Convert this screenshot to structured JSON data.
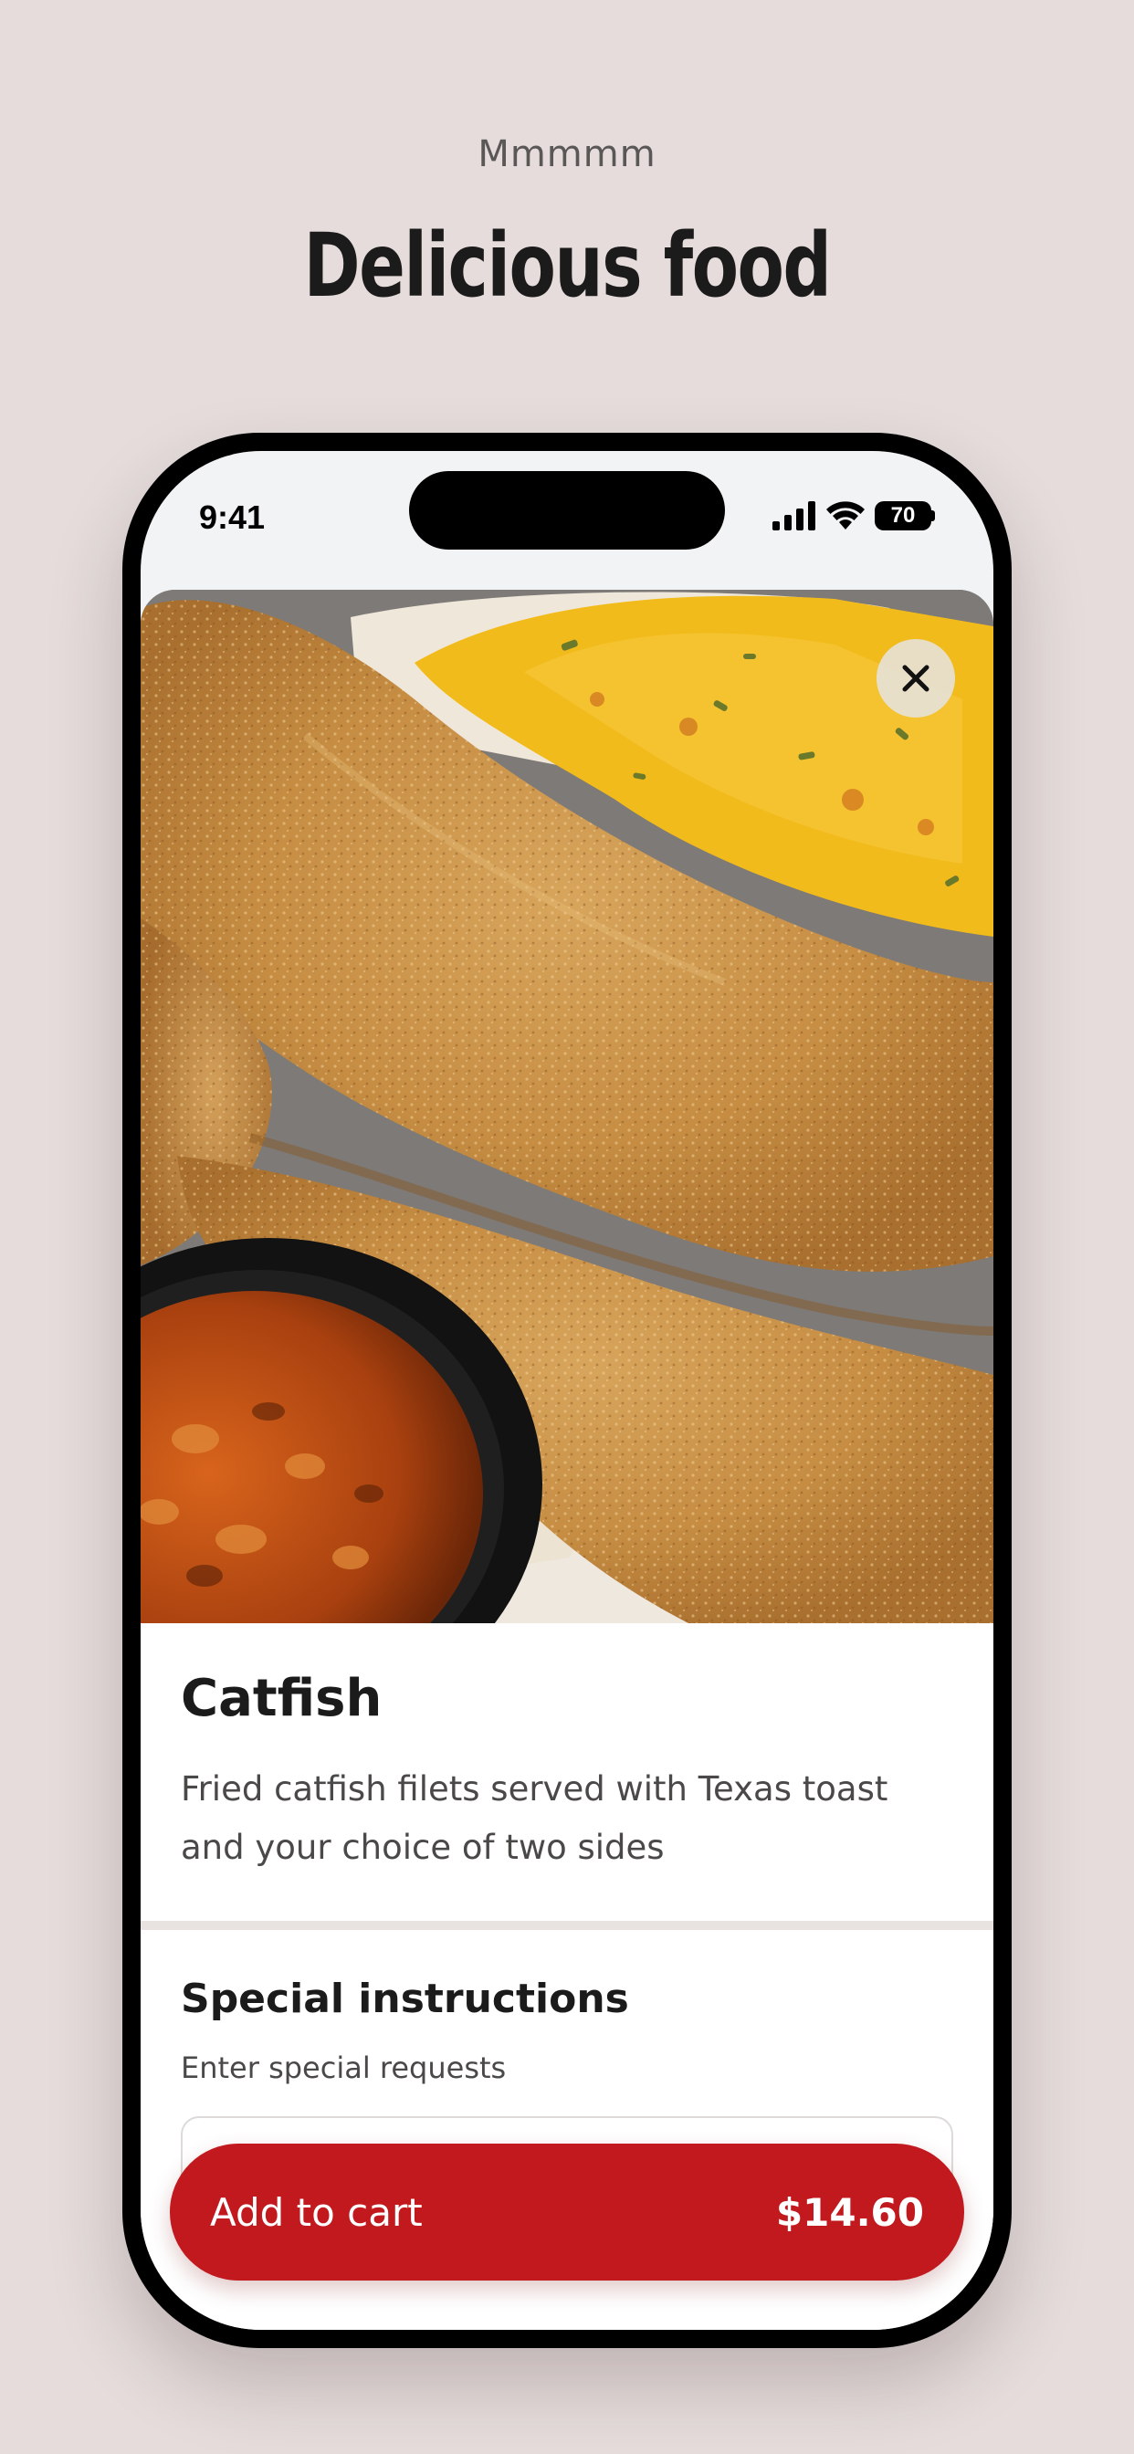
{
  "page": {
    "eyebrow": "Mmmmm",
    "headline": "Delicious food"
  },
  "status_bar": {
    "time": "9:41",
    "battery": "70",
    "icons": [
      "signal-icon",
      "wifi-icon",
      "battery-icon"
    ]
  },
  "item": {
    "image": "fried-catfish-photo",
    "title": "Catfish",
    "description": "Fried catfish filets served with Texas toast and your choice of two sides"
  },
  "special_instructions": {
    "title": "Special instructions",
    "subtitle": "Enter special requests",
    "value": ""
  },
  "cart_button": {
    "label": "Add to cart",
    "price": "$14.60"
  },
  "colors": {
    "background": "#e5dcdb",
    "accent": "#c1191d",
    "text": "#1b1b1b"
  }
}
